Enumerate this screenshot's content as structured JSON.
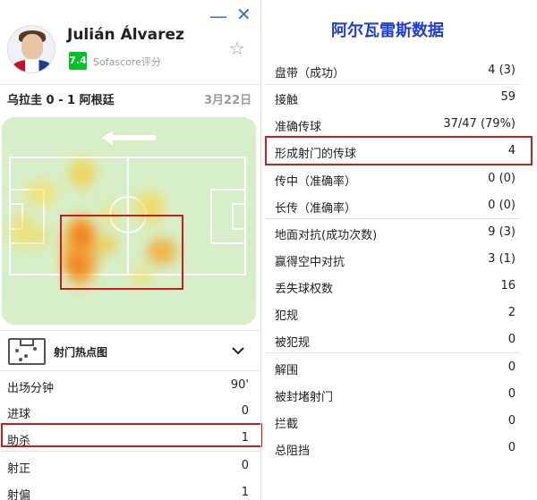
{
  "player": {
    "name": "Julián Álvarez",
    "rating": "7.4",
    "rating_source": "Sofascore评分"
  },
  "match": {
    "teams": "乌拉圭 0 - 1 阿根廷",
    "date": "3月22日"
  },
  "heatmap": {
    "attack_direction": "left",
    "shot_map_label": "射门热点图"
  },
  "left_stats": [
    {
      "label": "出场分钟",
      "value": "90'"
    },
    {
      "label": "进球",
      "value": "0"
    },
    {
      "label": "助杀",
      "value": "1"
    },
    {
      "label": "射正",
      "value": "0"
    },
    {
      "label": "射偏",
      "value": "1"
    }
  ],
  "right_panel": {
    "title": "阿尔瓦雷斯数据",
    "stats": [
      {
        "label": "盘带（成功）",
        "value": "4 (3)"
      },
      {
        "label": "接触",
        "value": "59"
      },
      {
        "label": "准确传球",
        "value": "37/47 (79%)"
      },
      {
        "label": "形成射门的传球",
        "value": "4"
      },
      {
        "label": "传中（准确率）",
        "value": "0 (0)"
      },
      {
        "label": "长传（准确率）",
        "value": "0 (0)"
      },
      {
        "label": "地面对抗(成功次数)",
        "value": "9 (3)"
      },
      {
        "label": "赢得空中对抗",
        "value": "3 (1)"
      },
      {
        "label": "丢失球权数",
        "value": "16"
      },
      {
        "label": "犯规",
        "value": "2"
      },
      {
        "label": "被犯规",
        "value": "0"
      },
      {
        "label": "解围",
        "value": "0"
      },
      {
        "label": "被封堵射门",
        "value": "0"
      },
      {
        "label": "拦截",
        "value": "0"
      },
      {
        "label": "总阻挡",
        "value": "0"
      }
    ]
  },
  "colors": {
    "accent_blue": "#3b6fd8",
    "title_blue": "#1c3be0",
    "rating_green": "#00c424",
    "highlight_red": "#c81e1e",
    "pitch_green": "#d7efc8"
  },
  "icons": [
    "minimize-icon",
    "close-icon",
    "star-icon",
    "arrow-left-icon",
    "chevron-down-icon",
    "shot-map-icon"
  ]
}
